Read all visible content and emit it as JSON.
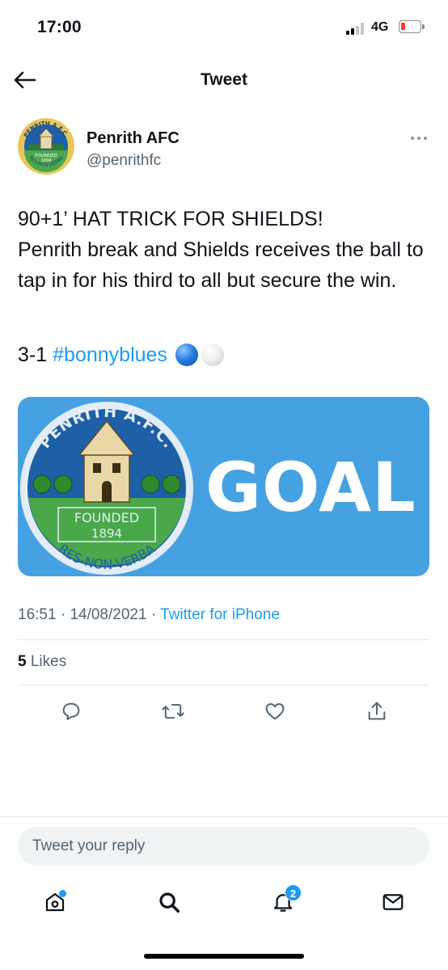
{
  "status_bar": {
    "time": "17:00",
    "network": "4G",
    "signal_bars_active": 2,
    "battery_level": 0.12,
    "battery_color": "#ff3b30"
  },
  "header": {
    "title": "Tweet",
    "back_icon": "arrow-left-icon"
  },
  "author": {
    "name": "Penrith AFC",
    "handle": "@penrithfc",
    "avatar_icon": "club-crest-logo",
    "avatar_text": {
      "top": "PENRITH A.F.C.",
      "founded": "FOUNDED",
      "year": "1894",
      "motto": "RES-NON-VERBA"
    }
  },
  "tweet": {
    "lines": [
      "90+1’ HAT TRICK FOR SHIELDS!",
      "Penrith break and Shields receives the ball to tap in for his third to all but secure the win."
    ],
    "score": "3-1",
    "hashtag": "#bonnyblues",
    "emojis": [
      "blue-circle",
      "white-circle"
    ]
  },
  "media": {
    "word": "GOAL",
    "crest_text": {
      "top": "PENRITH A.F.C.",
      "founded": "FOUNDED",
      "year": "1894",
      "motto": "RES-NON-VERBA"
    },
    "background_color": "#46a1e3"
  },
  "meta": {
    "time": "16:51",
    "date": "14/08/2021",
    "separator": "·",
    "source": "Twitter for iPhone"
  },
  "engagement": {
    "likes_count": "5",
    "likes_label": "Likes"
  },
  "actions": [
    "reply-icon",
    "retweet-icon",
    "like-icon",
    "share-icon"
  ],
  "reply": {
    "placeholder": "Tweet your reply"
  },
  "tabbar": {
    "items": [
      "home-icon",
      "search-icon",
      "notifications-icon",
      "messages-icon"
    ],
    "notifications_badge": "2"
  },
  "colors": {
    "accent": "#1d9bf0",
    "secondary_text": "#536471",
    "crest_blue": "#1f5fa8",
    "crest_green": "#4aa84a",
    "crest_gold": "#e8c75a"
  }
}
